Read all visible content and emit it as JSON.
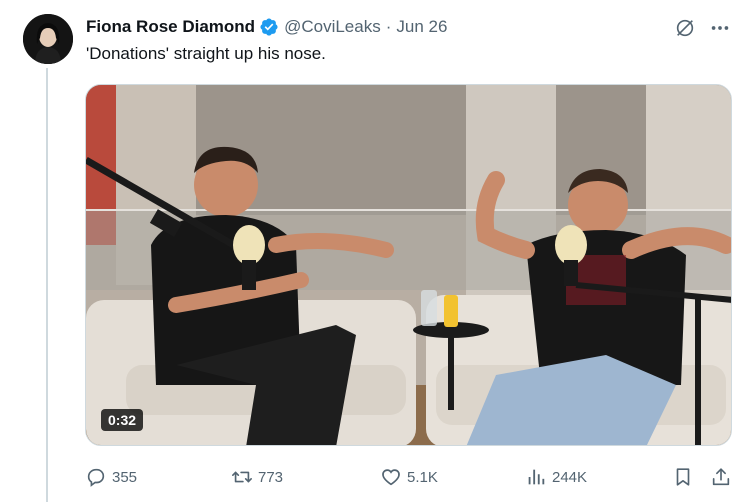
{
  "author": {
    "name": "Fiona Rose Diamond",
    "handle": "@CoviLeaks",
    "separator": "·",
    "time": "Jun 26"
  },
  "tweet": {
    "text": "'Donations' straight up his nose."
  },
  "media": {
    "duration": "0:32"
  },
  "actions": {
    "replies": "355",
    "reposts": "773",
    "likes": "5.1K",
    "views": "244K"
  },
  "colors": {
    "text": "#0f1419",
    "secondary": "#536471",
    "verified": "#1d9bf0",
    "divider": "#cfd9de"
  }
}
